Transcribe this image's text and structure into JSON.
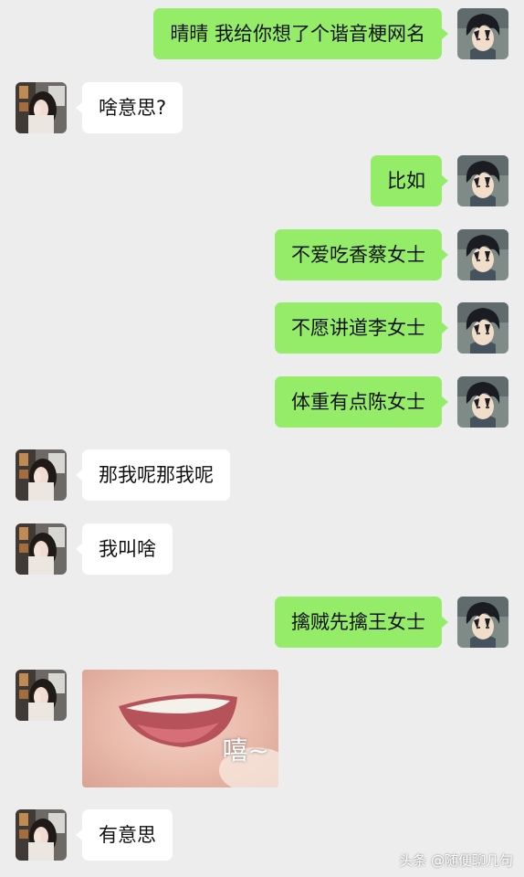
{
  "messages": [
    {
      "from": "me",
      "text": "晴晴 我给你想了个谐音梗网名"
    },
    {
      "from": "her",
      "text": "啥意思?"
    },
    {
      "from": "me",
      "text": "比如"
    },
    {
      "from": "me",
      "text": "不爱吃香蔡女士"
    },
    {
      "from": "me",
      "text": "不愿讲道李女士"
    },
    {
      "from": "me",
      "text": "体重有点陈女士"
    },
    {
      "from": "her",
      "text": "那我呢那我呢"
    },
    {
      "from": "her",
      "text": "我叫啥"
    },
    {
      "from": "me",
      "text": "擒贼先擒王女士"
    },
    {
      "from": "her",
      "sticker_caption": "嘻~"
    },
    {
      "from": "her",
      "text": "有意思"
    }
  ],
  "watermark": "头条 @随便聊几句",
  "colors": {
    "background": "#ededed",
    "me_bubble": "#95ec69",
    "her_bubble": "#ffffff"
  }
}
